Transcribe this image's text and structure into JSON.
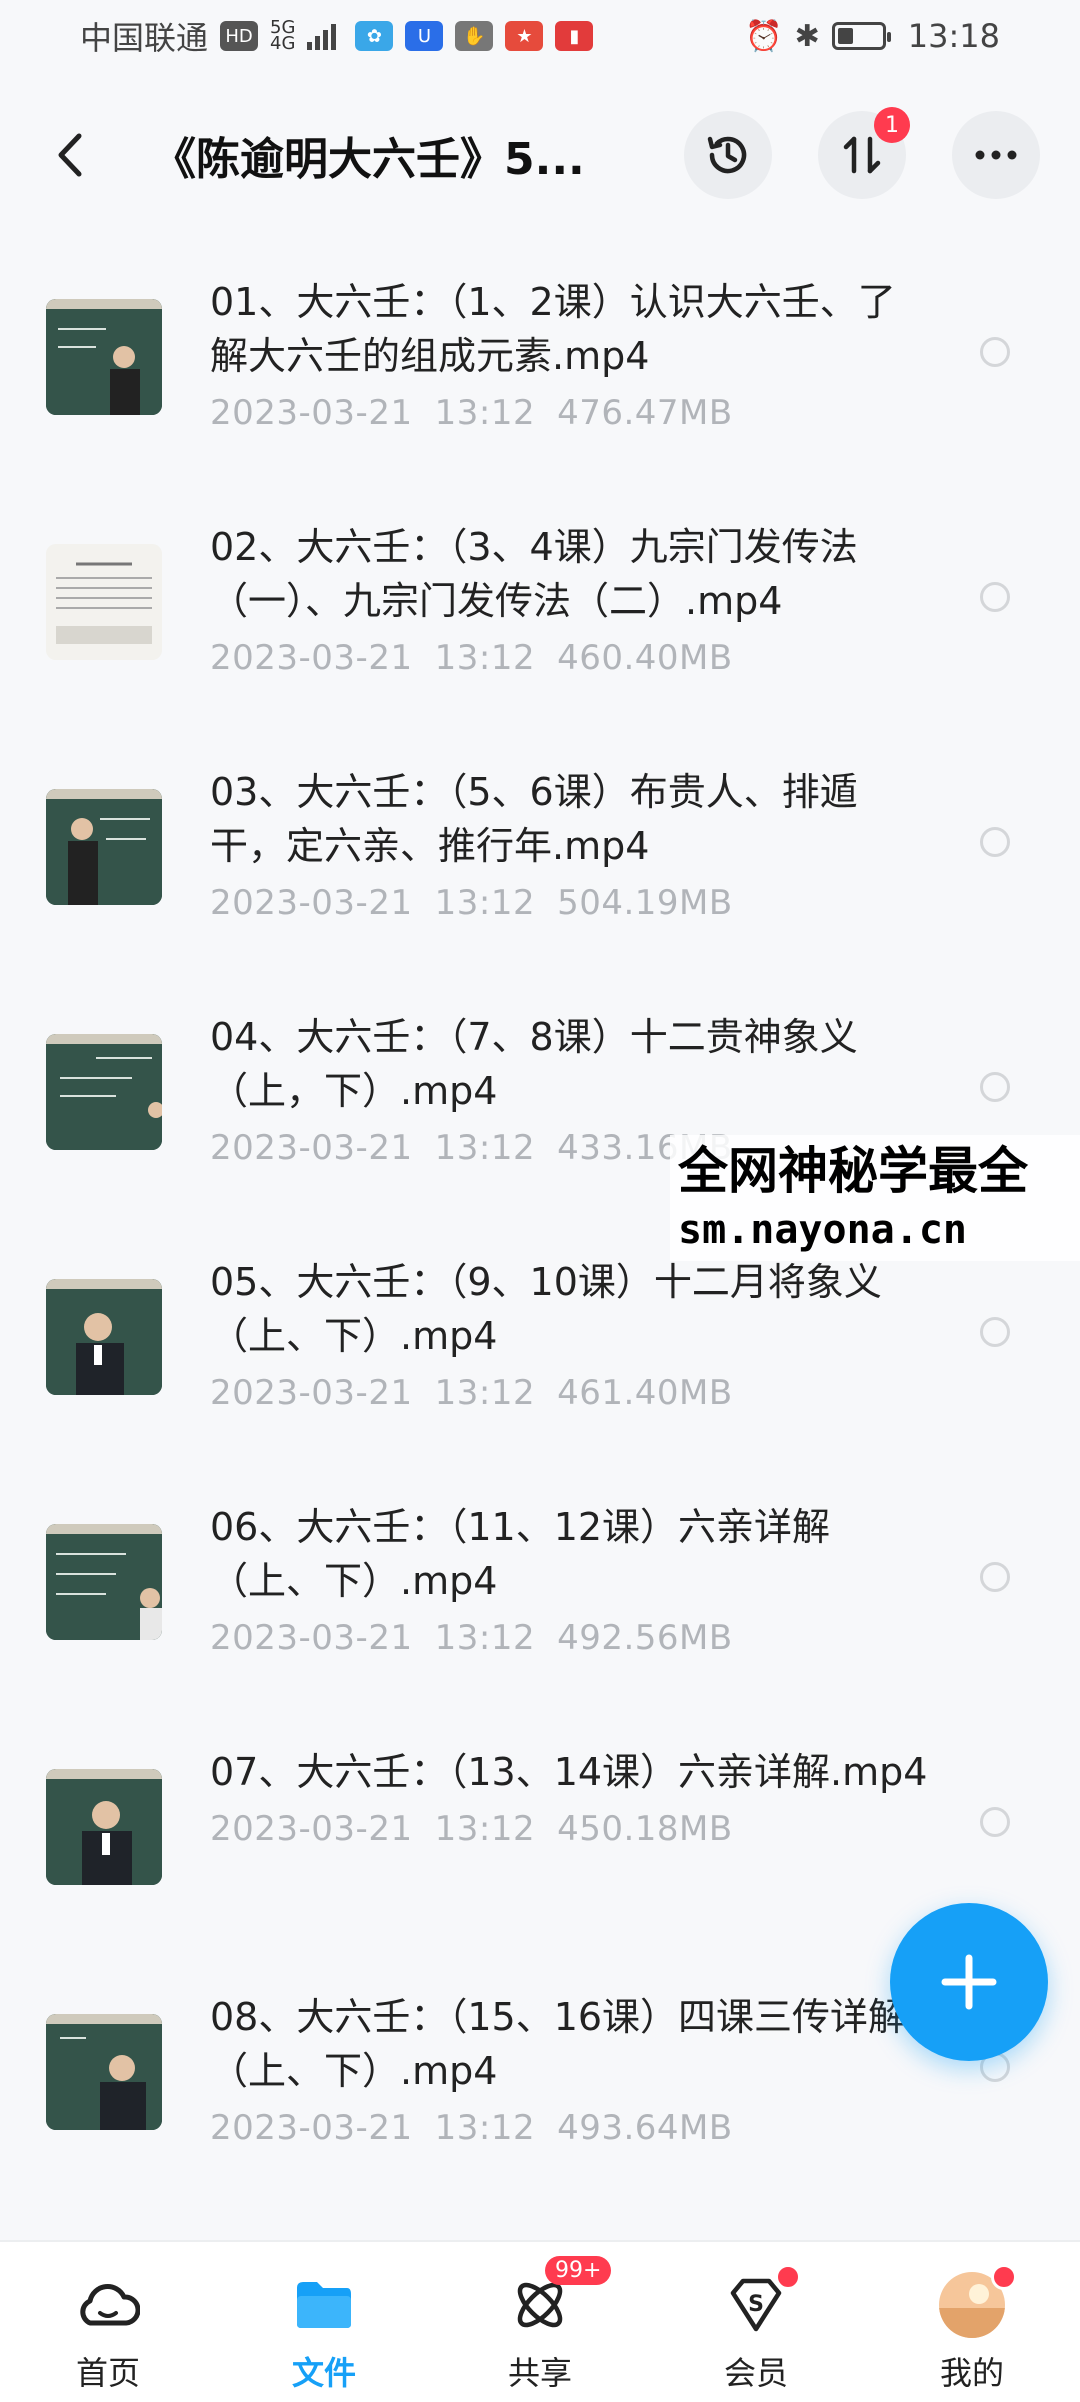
{
  "status_bar": {
    "carrier": "中国联通",
    "hd": "HD",
    "signal_top": "5G",
    "signal_bottom": "4G",
    "time": "13:18",
    "battery_level": 0.35
  },
  "header": {
    "title": "《陈逾明大六壬》5...",
    "transfer_badge": "1"
  },
  "files": [
    {
      "name": "01、大六壬：（1、2课）认识大六壬、了解大六壬的组成元素.mp4",
      "date": "2023-03-21",
      "time": "13:12",
      "size": "476.47MB"
    },
    {
      "name": "02、大六壬：（3、4课）九宗门发传法（一）、九宗门发传法（二）.mp4",
      "date": "2023-03-21",
      "time": "13:12",
      "size": "460.40MB"
    },
    {
      "name": "03、大六壬：（5、6课）布贵人、排遁干，定六亲、推行年.mp4",
      "date": "2023-03-21",
      "time": "13:12",
      "size": "504.19MB"
    },
    {
      "name": "04、大六壬：（7、8课）十二贵神象义（上，下）.mp4",
      "date": "2023-03-21",
      "time": "13:12",
      "size": "433.16MB"
    },
    {
      "name": "05、大六壬：（9、10课）十二月将象义（上、下）.mp4",
      "date": "2023-03-21",
      "time": "13:12",
      "size": "461.40MB"
    },
    {
      "name": "06、大六壬：（11、12课）六亲详解（上、下）.mp4",
      "date": "2023-03-21",
      "time": "13:12",
      "size": "492.56MB"
    },
    {
      "name": "07、大六壬：（13、14课）六亲详解.mp4",
      "date": "2023-03-21",
      "time": "13:12",
      "size": "450.18MB"
    },
    {
      "name": "08、大六壬：（15、16课）四课三传详解（上、下）.mp4",
      "date": "2023-03-21",
      "time": "13:12",
      "size": "493.64MB"
    }
  ],
  "watermark": {
    "line1": "全网神秘学最全",
    "line2": "sm.nayona.cn"
  },
  "bottom_nav": {
    "items": [
      {
        "label": "首页",
        "icon": "cloud-home-icon"
      },
      {
        "label": "文件",
        "icon": "folder-icon"
      },
      {
        "label": "共享",
        "icon": "share-orbit-icon",
        "badge": "99+"
      },
      {
        "label": "会员",
        "icon": "vip-diamond-icon"
      },
      {
        "label": "我的",
        "icon": "avatar-icon"
      }
    ]
  },
  "colors": {
    "accent": "#16a0f7",
    "badge": "#ff3b4f",
    "meta_text": "#b1b4b9"
  }
}
